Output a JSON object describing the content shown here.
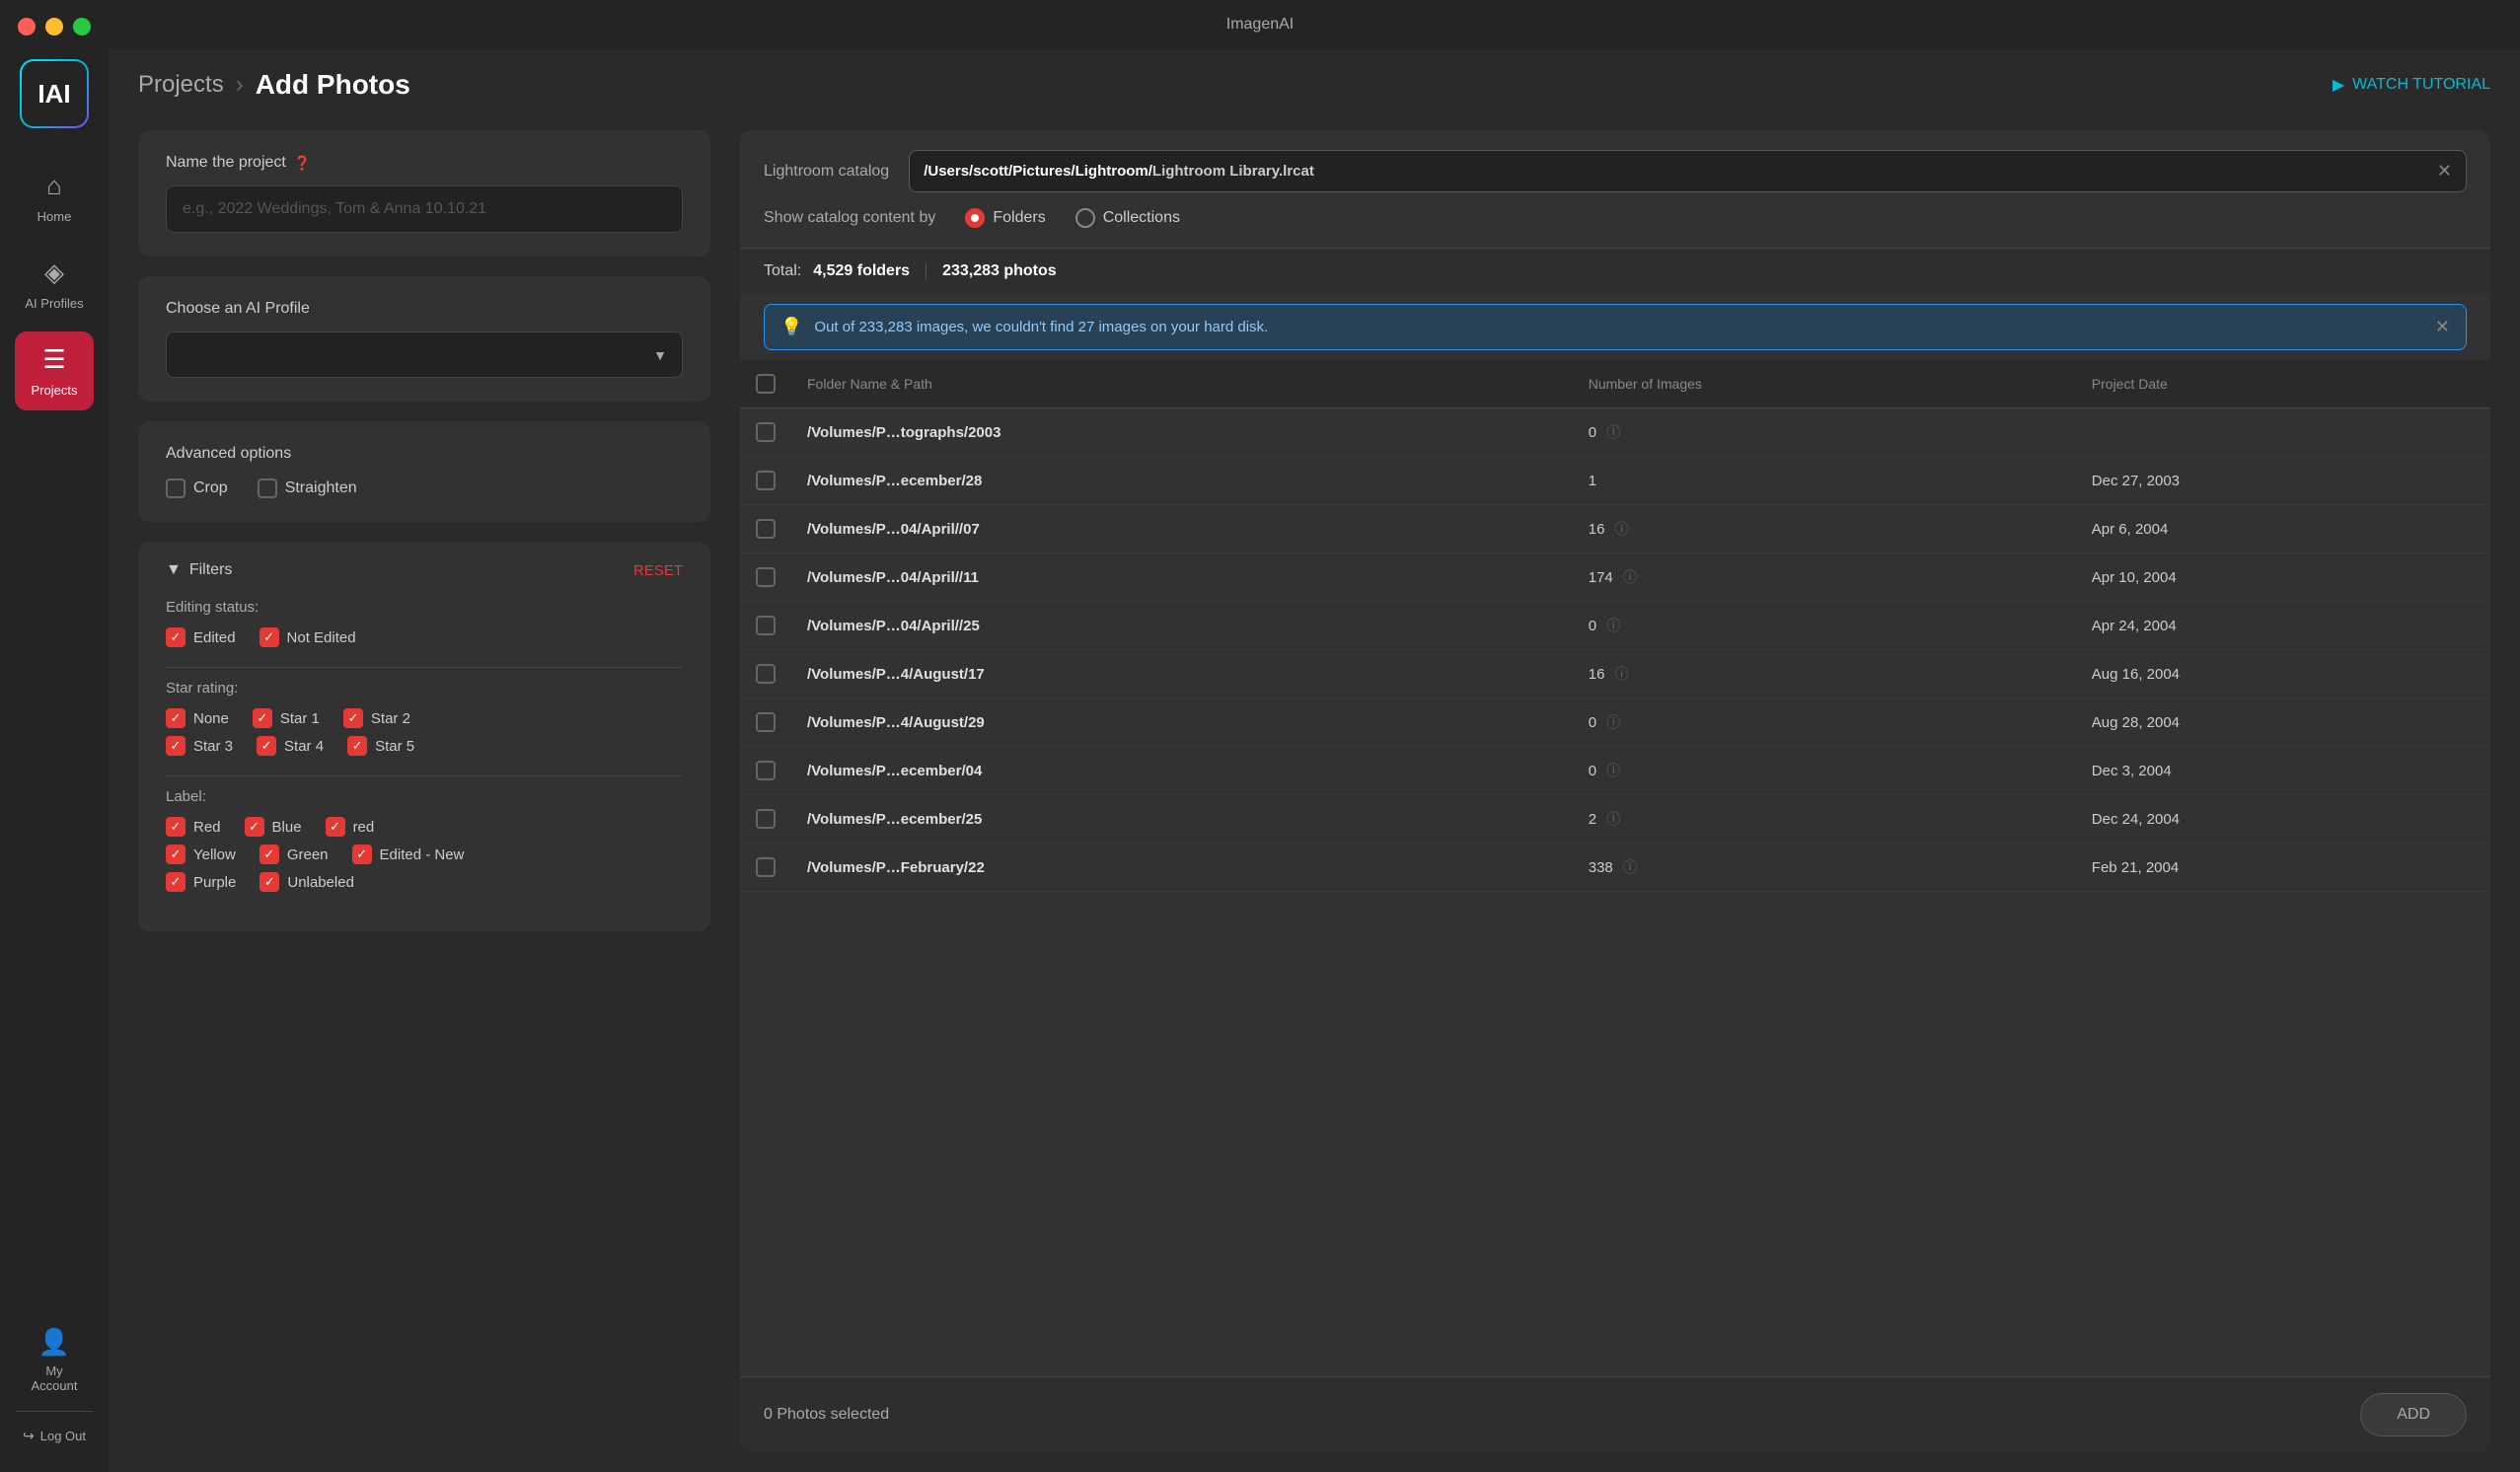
{
  "app": {
    "title": "ImagenAI"
  },
  "titlebar": {
    "text": "ImagenAI"
  },
  "sidebar": {
    "logo": "IAI",
    "nav_items": [
      {
        "id": "home",
        "label": "Home",
        "icon": "⌂",
        "active": false
      },
      {
        "id": "ai-profiles",
        "label": "AI Profiles",
        "icon": "◈",
        "active": false
      },
      {
        "id": "projects",
        "label": "Projects",
        "icon": "☰",
        "active": true
      }
    ],
    "account_label": "My Account",
    "logout_label": "Log Out"
  },
  "header": {
    "breadcrumb_parent": "Projects",
    "breadcrumb_sep": "›",
    "breadcrumb_current": "Add Photos",
    "watch_tutorial": "WATCH TUTORIAL"
  },
  "left_panel": {
    "name_label": "Name the project",
    "name_placeholder": "e.g., 2022 Weddings, Tom & Anna 10.10.21",
    "ai_profile_label": "Choose an AI Profile",
    "ai_profile_placeholder": "",
    "advanced_options_label": "Advanced options",
    "crop_label": "Crop",
    "straighten_label": "Straighten",
    "filters_label": "Filters",
    "reset_label": "RESET",
    "editing_status_label": "Editing status:",
    "edited_label": "Edited",
    "not_edited_label": "Not Edited",
    "star_rating_label": "Star rating:",
    "star_none": "None",
    "star_1": "Star 1",
    "star_2": "Star 2",
    "star_3": "Star 3",
    "star_4": "Star 4",
    "star_5": "Star 5",
    "label_label": "Label:",
    "red": "Red",
    "blue": "Blue",
    "red2": "red",
    "yellow": "Yellow",
    "green": "Green",
    "edited_new": "Edited - New",
    "purple": "Purple",
    "unlabeled": "Unlabeled"
  },
  "right_panel": {
    "catalog_label": "Lightroom catalog",
    "catalog_path_prefix": "/Users/scott/Pictures/Lightroom/",
    "catalog_path_bold": "Lightroom Library.lrcat",
    "view_label": "Show catalog content by",
    "folders_label": "Folders",
    "collections_label": "Collections",
    "total_label": "Total:",
    "total_folders": "4,529 folders",
    "total_photos": "233,283 photos",
    "warning_text": "Out of 233,283 images, we couldn't find 27 images on your hard disk.",
    "table_headers": [
      "",
      "Folder Name & Path",
      "Number of Images",
      "Project Date"
    ],
    "rows": [
      {
        "path": "/Volumes/P…tographs/2003",
        "images": "0",
        "date": "",
        "has_info": true
      },
      {
        "path": "/Volumes/P…ecember/28",
        "images": "1",
        "date": "Dec 27, 2003",
        "has_info": false
      },
      {
        "path": "/Volumes/P…04/April//07",
        "images": "16",
        "date": "Apr 6, 2004",
        "has_info": true
      },
      {
        "path": "/Volumes/P…04/April//11",
        "images": "174",
        "date": "Apr 10, 2004",
        "has_info": true
      },
      {
        "path": "/Volumes/P…04/April//25",
        "images": "0",
        "date": "Apr 24, 2004",
        "has_info": true
      },
      {
        "path": "/Volumes/P…4/August/17",
        "images": "16",
        "date": "Aug 16, 2004",
        "has_info": true
      },
      {
        "path": "/Volumes/P…4/August/29",
        "images": "0",
        "date": "Aug 28, 2004",
        "has_info": true
      },
      {
        "path": "/Volumes/P…ecember/04",
        "images": "0",
        "date": "Dec 3, 2004",
        "has_info": true
      },
      {
        "path": "/Volumes/P…ecember/25",
        "images": "2",
        "date": "Dec 24, 2004",
        "has_info": true
      },
      {
        "path": "/Volumes/P…February/22",
        "images": "338",
        "date": "Feb 21, 2004",
        "has_info": true
      }
    ],
    "photos_selected": "0 Photos selected",
    "add_btn_label": "ADD"
  }
}
